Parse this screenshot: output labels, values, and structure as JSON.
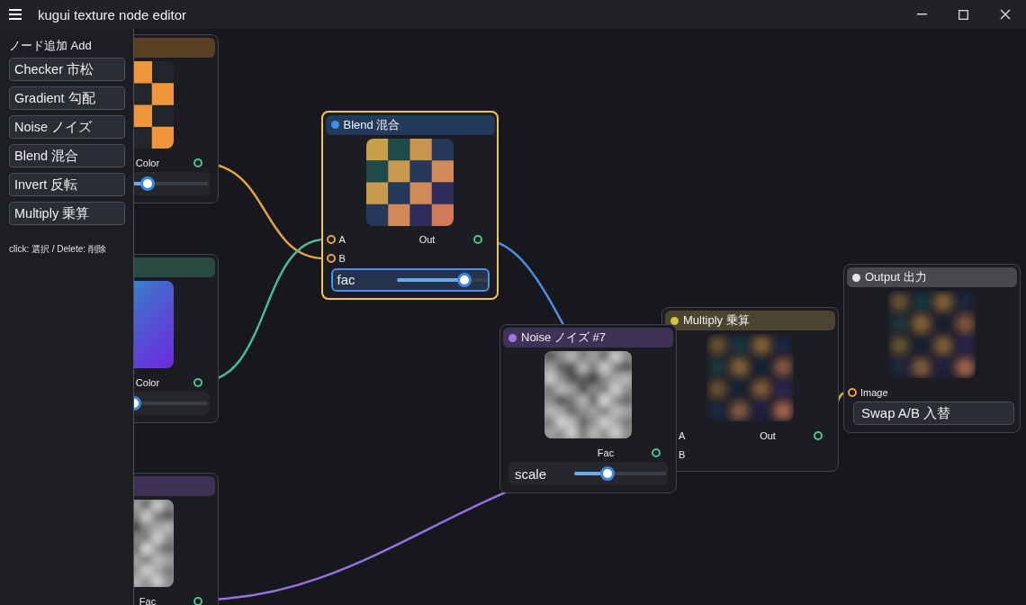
{
  "window": {
    "title": "kugui texture node editor"
  },
  "sidebar": {
    "heading": "ノード追加 Add",
    "buttons": [
      "Checker 市松",
      "Gradient 勾配",
      "Noise ノイズ",
      "Blend 混合",
      "Invert 反転",
      "Multiply 乗算"
    ],
    "hint": "click: 選択 / Delete: 削除"
  },
  "nodes": [
    {
      "kind": "checker",
      "selected": false,
      "outputs": [
        "Color"
      ],
      "param": {
        "level": 0.34,
        "focused": false
      }
    },
    {
      "kind": "gradient",
      "selected": false,
      "outputs": [
        "Color"
      ],
      "param": {
        "level": 0.2,
        "focused": false
      }
    },
    {
      "kind": "noise",
      "selected": false,
      "outputs": [
        "Fac"
      ]
    },
    {
      "kind": "blend",
      "title": "Blend 混合",
      "color": "#3b8eea",
      "selected": true,
      "inputs": [
        "A",
        "B"
      ],
      "outputs": [
        "Out"
      ],
      "param": {
        "label": "fac",
        "level": 0.75,
        "focused": true
      }
    },
    {
      "kind": "multiply",
      "title": "Multiply 乗算",
      "color": "#d9c043",
      "selected": false,
      "inputs": [
        "A",
        "B"
      ],
      "outputs": [
        "Out"
      ]
    },
    {
      "kind": "noise",
      "title": "Noise ノイズ #7",
      "color": "#a374e8",
      "selected": false,
      "outputs": [
        "Fac"
      ],
      "param": {
        "label": "scale",
        "level": 0.36,
        "focused": false
      }
    },
    {
      "kind": "output",
      "title": "Output 出力",
      "color": "#e6e6e6",
      "selected": false,
      "inputs": [
        "Image"
      ],
      "button": "Swap A/B 入替"
    }
  ],
  "wires": [
    {
      "color": "#e8a33d"
    },
    {
      "color": "#4fb89a"
    },
    {
      "color": "#4a90e0"
    },
    {
      "color": "#9a70e0"
    },
    {
      "color": "#d8b040"
    }
  ]
}
